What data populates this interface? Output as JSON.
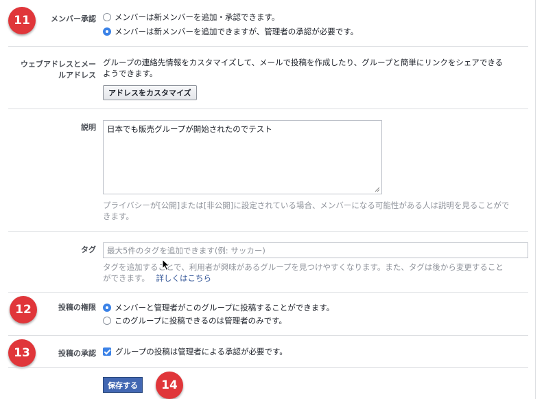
{
  "badges": [
    "11",
    "12",
    "13",
    "14"
  ],
  "member_approval": {
    "label": "メンバー承認",
    "options": [
      {
        "text": "メンバーは新メンバーを追加・承認できます。",
        "selected": false
      },
      {
        "text": "メンバーは新メンバーを追加できますが、管理者の承認が必要です。",
        "selected": true
      }
    ]
  },
  "web_address": {
    "label_line1": "ウェブアドレスとメー",
    "label_line2": "ルアドレス",
    "description_line1": "グループの連絡先情報をカスタマイズして、メールで投稿を作成したり、グループと簡単にリンクをシェアできる",
    "description_line2": "ようできます。",
    "button_label": "アドレスをカスタマイズ"
  },
  "description": {
    "label": "説明",
    "value": "日本でも販売グループが開始されたのでテスト",
    "helper_line1": "プライバシーが[公開]または[非公開]に設定されている場合、メンバーになる可能性がある人は説明を見ることがで",
    "helper_line2": "きます。"
  },
  "tags": {
    "label": "タグ",
    "placeholder": "最大5件のタグを追加できます(例: サッカー)",
    "helper_line1": "タグを追加することで、利用者が興味があるグループを見つけやすくなります。また、タグは後から変更すること",
    "helper_line2": "ができます。",
    "learn_more": "詳しくはこちら"
  },
  "posting_permissions": {
    "label": "投稿の権限",
    "options": [
      {
        "text": "メンバーと管理者がこのグループに投稿することができます。",
        "selected": true
      },
      {
        "text": "このグループに投稿できるのは管理者のみです。",
        "selected": false
      }
    ]
  },
  "post_approval": {
    "label": "投稿の承認",
    "checkbox_text": "グループの投稿は管理者による承認が必要です。",
    "checked": true
  },
  "save_label": "保存する",
  "colors": {
    "accent": "#4267b2",
    "badge": "#e0363a",
    "control": "#3b82e7",
    "link": "#365899"
  }
}
